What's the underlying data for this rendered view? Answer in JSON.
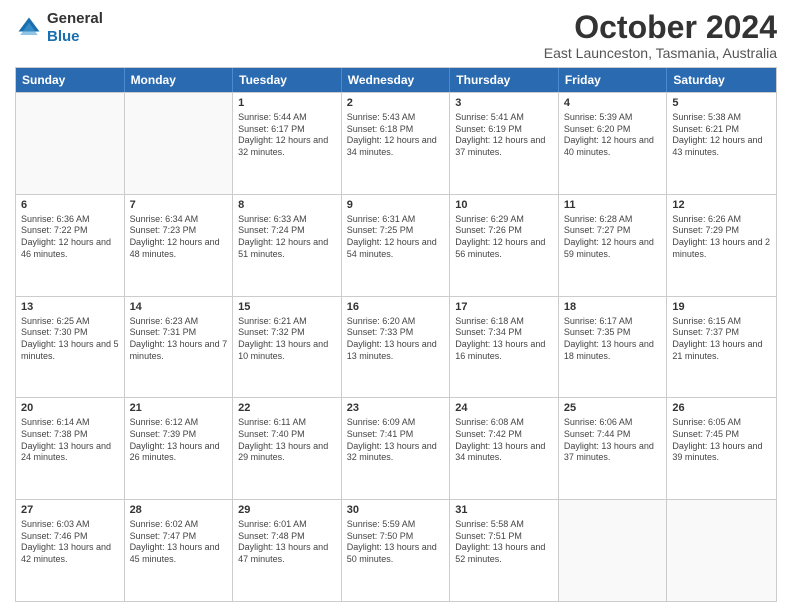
{
  "header": {
    "logo_line1": "General",
    "logo_line2": "Blue",
    "title": "October 2024",
    "subtitle": "East Launceston, Tasmania, Australia"
  },
  "calendar": {
    "days": [
      "Sunday",
      "Monday",
      "Tuesday",
      "Wednesday",
      "Thursday",
      "Friday",
      "Saturday"
    ],
    "rows": [
      [
        {
          "day": "",
          "info": ""
        },
        {
          "day": "",
          "info": ""
        },
        {
          "day": "1",
          "info": "Sunrise: 5:44 AM\nSunset: 6:17 PM\nDaylight: 12 hours and 32 minutes."
        },
        {
          "day": "2",
          "info": "Sunrise: 5:43 AM\nSunset: 6:18 PM\nDaylight: 12 hours and 34 minutes."
        },
        {
          "day": "3",
          "info": "Sunrise: 5:41 AM\nSunset: 6:19 PM\nDaylight: 12 hours and 37 minutes."
        },
        {
          "day": "4",
          "info": "Sunrise: 5:39 AM\nSunset: 6:20 PM\nDaylight: 12 hours and 40 minutes."
        },
        {
          "day": "5",
          "info": "Sunrise: 5:38 AM\nSunset: 6:21 PM\nDaylight: 12 hours and 43 minutes."
        }
      ],
      [
        {
          "day": "6",
          "info": "Sunrise: 6:36 AM\nSunset: 7:22 PM\nDaylight: 12 hours and 46 minutes."
        },
        {
          "day": "7",
          "info": "Sunrise: 6:34 AM\nSunset: 7:23 PM\nDaylight: 12 hours and 48 minutes."
        },
        {
          "day": "8",
          "info": "Sunrise: 6:33 AM\nSunset: 7:24 PM\nDaylight: 12 hours and 51 minutes."
        },
        {
          "day": "9",
          "info": "Sunrise: 6:31 AM\nSunset: 7:25 PM\nDaylight: 12 hours and 54 minutes."
        },
        {
          "day": "10",
          "info": "Sunrise: 6:29 AM\nSunset: 7:26 PM\nDaylight: 12 hours and 56 minutes."
        },
        {
          "day": "11",
          "info": "Sunrise: 6:28 AM\nSunset: 7:27 PM\nDaylight: 12 hours and 59 minutes."
        },
        {
          "day": "12",
          "info": "Sunrise: 6:26 AM\nSunset: 7:29 PM\nDaylight: 13 hours and 2 minutes."
        }
      ],
      [
        {
          "day": "13",
          "info": "Sunrise: 6:25 AM\nSunset: 7:30 PM\nDaylight: 13 hours and 5 minutes."
        },
        {
          "day": "14",
          "info": "Sunrise: 6:23 AM\nSunset: 7:31 PM\nDaylight: 13 hours and 7 minutes."
        },
        {
          "day": "15",
          "info": "Sunrise: 6:21 AM\nSunset: 7:32 PM\nDaylight: 13 hours and 10 minutes."
        },
        {
          "day": "16",
          "info": "Sunrise: 6:20 AM\nSunset: 7:33 PM\nDaylight: 13 hours and 13 minutes."
        },
        {
          "day": "17",
          "info": "Sunrise: 6:18 AM\nSunset: 7:34 PM\nDaylight: 13 hours and 16 minutes."
        },
        {
          "day": "18",
          "info": "Sunrise: 6:17 AM\nSunset: 7:35 PM\nDaylight: 13 hours and 18 minutes."
        },
        {
          "day": "19",
          "info": "Sunrise: 6:15 AM\nSunset: 7:37 PM\nDaylight: 13 hours and 21 minutes."
        }
      ],
      [
        {
          "day": "20",
          "info": "Sunrise: 6:14 AM\nSunset: 7:38 PM\nDaylight: 13 hours and 24 minutes."
        },
        {
          "day": "21",
          "info": "Sunrise: 6:12 AM\nSunset: 7:39 PM\nDaylight: 13 hours and 26 minutes."
        },
        {
          "day": "22",
          "info": "Sunrise: 6:11 AM\nSunset: 7:40 PM\nDaylight: 13 hours and 29 minutes."
        },
        {
          "day": "23",
          "info": "Sunrise: 6:09 AM\nSunset: 7:41 PM\nDaylight: 13 hours and 32 minutes."
        },
        {
          "day": "24",
          "info": "Sunrise: 6:08 AM\nSunset: 7:42 PM\nDaylight: 13 hours and 34 minutes."
        },
        {
          "day": "25",
          "info": "Sunrise: 6:06 AM\nSunset: 7:44 PM\nDaylight: 13 hours and 37 minutes."
        },
        {
          "day": "26",
          "info": "Sunrise: 6:05 AM\nSunset: 7:45 PM\nDaylight: 13 hours and 39 minutes."
        }
      ],
      [
        {
          "day": "27",
          "info": "Sunrise: 6:03 AM\nSunset: 7:46 PM\nDaylight: 13 hours and 42 minutes."
        },
        {
          "day": "28",
          "info": "Sunrise: 6:02 AM\nSunset: 7:47 PM\nDaylight: 13 hours and 45 minutes."
        },
        {
          "day": "29",
          "info": "Sunrise: 6:01 AM\nSunset: 7:48 PM\nDaylight: 13 hours and 47 minutes."
        },
        {
          "day": "30",
          "info": "Sunrise: 5:59 AM\nSunset: 7:50 PM\nDaylight: 13 hours and 50 minutes."
        },
        {
          "day": "31",
          "info": "Sunrise: 5:58 AM\nSunset: 7:51 PM\nDaylight: 13 hours and 52 minutes."
        },
        {
          "day": "",
          "info": ""
        },
        {
          "day": "",
          "info": ""
        }
      ]
    ]
  }
}
